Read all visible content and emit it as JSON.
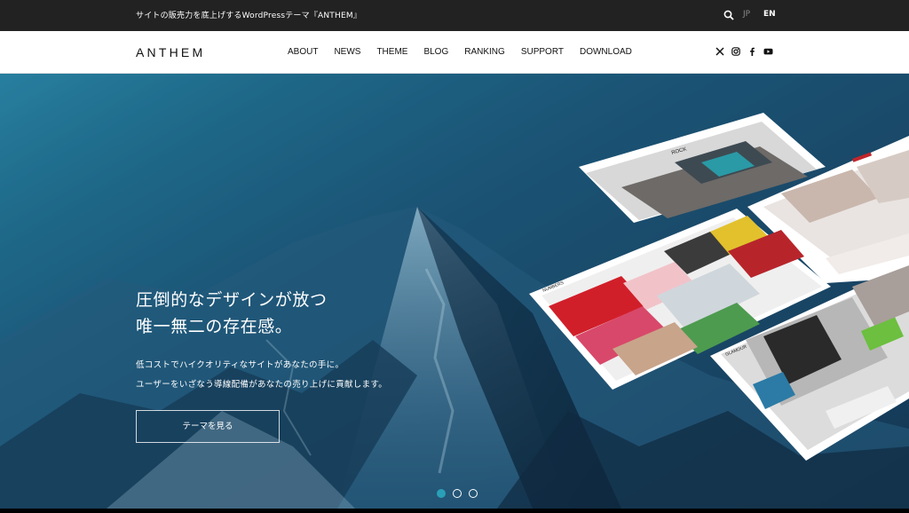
{
  "topbar": {
    "tagline": "サイトの販売力を底上げするWordPressテーマ『ANTHEM』",
    "lang_jp": "JP",
    "lang_en": "EN",
    "search_icon": "search-icon"
  },
  "header": {
    "logo": "ANTHEM",
    "nav": [
      "ABOUT",
      "NEWS",
      "THEME",
      "BLOG",
      "RANKING",
      "SUPPORT",
      "DOWNLOAD"
    ],
    "social": [
      "x-icon",
      "instagram-icon",
      "facebook-icon",
      "youtube-icon"
    ]
  },
  "hero": {
    "title_line1": "圧倒的なデザインが放つ",
    "title_line2": "唯一無二の存在感。",
    "desc_line1": "低コストでハイクオリティなサイトがあなたの手に。",
    "desc_line2": "ユーザーをいざなう導線配備があなたの売り上げに貢献します。",
    "button": "テーマを見る",
    "mockups": {
      "rock": "ROCK",
      "numbers": "NUMBERS",
      "glamour": "GLAMOUR"
    }
  },
  "slider": {
    "count": 3,
    "active_index": 0
  },
  "colors": {
    "topbar": "#222222",
    "accent": "#2aa0b8",
    "hero": "#1c5576"
  }
}
